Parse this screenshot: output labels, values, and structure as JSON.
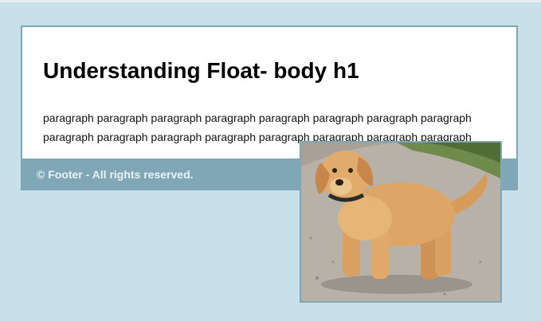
{
  "heading": "Understanding Float- body h1",
  "paragraph": "paragraph paragraph paragraph paragraph paragraph paragraph paragraph paragraph paragraph paragraph paragraph paragraph paragraph paragraph paragraph paragraph",
  "footer": "© Footer - All rights reserved.",
  "colors": {
    "page_background": "#c8e0ea",
    "container_border": "#7fa7b6",
    "footer_background": "#7fa7b6",
    "footer_text": "#eaf3f7"
  },
  "image": {
    "icon": "puppy-photo"
  }
}
